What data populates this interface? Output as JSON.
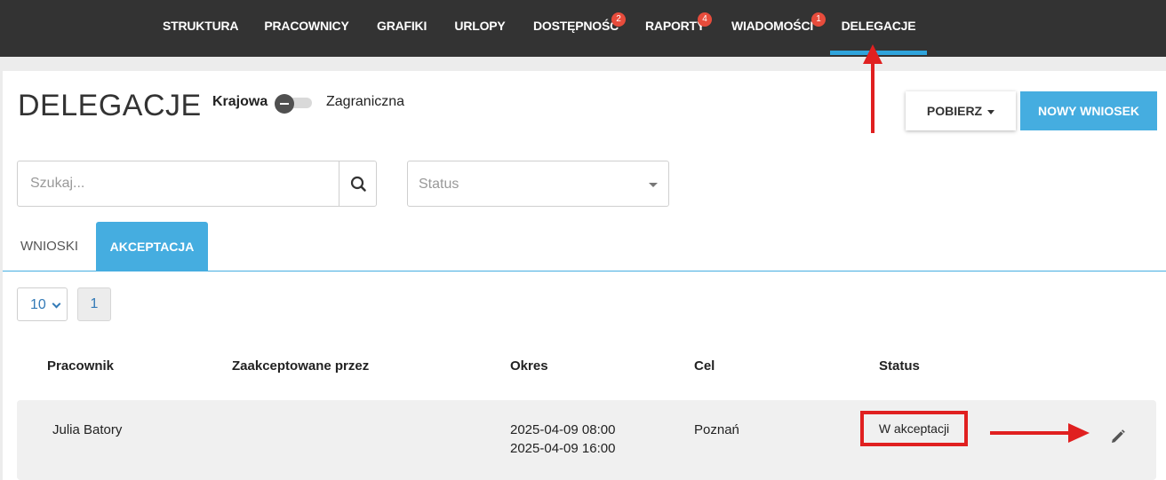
{
  "nav": {
    "items": [
      {
        "label": "STRUKTURA",
        "badge": null
      },
      {
        "label": "PRACOWNICY",
        "badge": null
      },
      {
        "label": "GRAFIKI",
        "badge": null
      },
      {
        "label": "URLOPY",
        "badge": null
      },
      {
        "label": "DOSTĘPNOŚĆ",
        "badge": "2"
      },
      {
        "label": "RAPORTY",
        "badge": "4"
      },
      {
        "label": "WIADOMOŚCI",
        "badge": "1"
      },
      {
        "label": "DELEGACJE",
        "badge": null
      }
    ],
    "active": "DELEGACJE"
  },
  "header": {
    "title": "DELEGACJE",
    "toggle_left": "Krajowa",
    "toggle_right": "Zagraniczna",
    "download_label": "POBIERZ",
    "new_request_label": "NOWY WNIOSEK"
  },
  "filters": {
    "search_placeholder": "Szukaj...",
    "status_placeholder": "Status"
  },
  "tabs": [
    {
      "label": "WNIOSKI",
      "active": false
    },
    {
      "label": "AKCEPTACJA",
      "active": true
    }
  ],
  "pagination": {
    "per_page": "10",
    "current_page": "1"
  },
  "table": {
    "columns": [
      "Pracownik",
      "Zaakceptowane przez",
      "Okres",
      "Cel",
      "Status"
    ],
    "rows": [
      {
        "employee": "Julia Batory",
        "accepted_by": "",
        "period_start": "2025-04-09 08:00",
        "period_end": "2025-04-09 16:00",
        "destination": "Poznań",
        "status": "W akceptacji"
      }
    ]
  },
  "colors": {
    "nav_bg": "#333333",
    "accent": "#45ade0",
    "annotation_red": "#e02020",
    "badge_red": "#e74c3c"
  },
  "icons": {
    "search": "search-icon",
    "edit": "pencil-icon",
    "toggle": "minus-icon"
  }
}
